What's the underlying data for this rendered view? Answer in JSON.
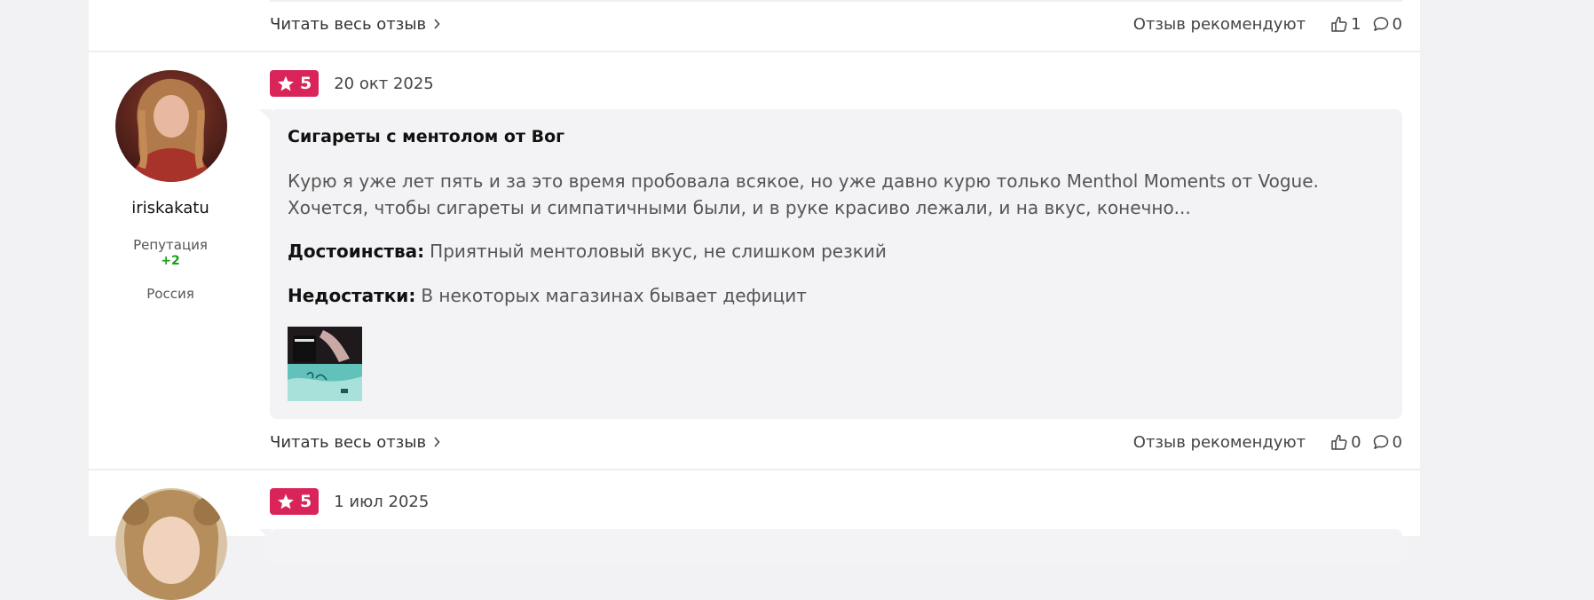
{
  "previous_review": {
    "read_more": "Читать весь отзыв",
    "recommend_label": "Отзыв рекомендуют",
    "likes": "1",
    "comments": "0"
  },
  "review": {
    "user": {
      "name": "iriskakatu",
      "reputation_label": "Репутация",
      "reputation_value": "+2",
      "country": "Россия"
    },
    "rating": "5",
    "date": "20 окт 2025",
    "title": "Сигареты с ментолом от Вог",
    "text": "Курю я уже лет пять и за это время пробовала всякое, но уже давно курю только Menthol Moments от Vogue. Хочется, чтобы сигареты и симпатичными были, и в руке красиво лежали, и на вкус, конечно...",
    "pros_label": "Достоинства:",
    "pros": "Приятный ментоловый вкус, не слишком резкий",
    "cons_label": "Недостатки:",
    "cons": "В некоторых магазинах бывает дефицит",
    "read_more": "Читать весь отзыв",
    "recommend_label": "Отзыв рекомендуют",
    "likes": "0",
    "comments": "0"
  },
  "next_review": {
    "rating": "5",
    "date": "1 июл 2025"
  },
  "colors": {
    "badge": "#d9245a",
    "reputation": "#19a019",
    "box_bg": "#f3f3f5"
  }
}
